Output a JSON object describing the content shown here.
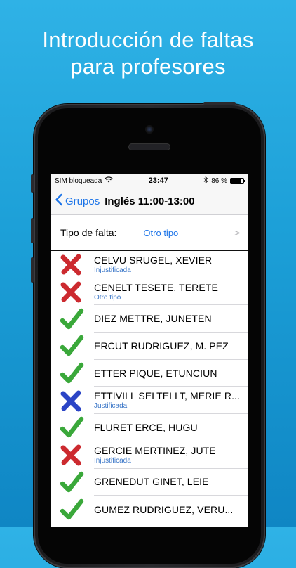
{
  "headline": {
    "line1": "Introducción de faltas",
    "line2": "para profesores"
  },
  "status_bar": {
    "carrier": "SIM bloqueada",
    "time": "23:47",
    "battery_text": "86 %",
    "battery_level": 0.86
  },
  "nav": {
    "back_label": "Grupos",
    "title": "Inglés 11:00-13:00"
  },
  "filter": {
    "label": "Tipo de falta:",
    "value": "Otro tipo",
    "chevron": ">"
  },
  "colors": {
    "red": "#cc2a2f",
    "green": "#3aa83a",
    "blue": "#2b45c6",
    "ios_blue": "#1a73e8"
  },
  "students": [
    {
      "name": "CELVU SRUGEL, XEVIER",
      "status": "cross-red",
      "note": "Injustificada"
    },
    {
      "name": "CENELT TESETE, TERETE",
      "status": "cross-red",
      "note": "Otro tipo"
    },
    {
      "name": "DIEZ METTRE, JUNETEN",
      "status": "check-green",
      "note": ""
    },
    {
      "name": "ERCUT RUDRIGUEZ, M. PEZ",
      "status": "check-green",
      "note": ""
    },
    {
      "name": "ETTER PIQUE, ETUNCIUN",
      "status": "check-green",
      "note": ""
    },
    {
      "name": "ETTIVILL SELTELLT, MERIE R...",
      "status": "cross-blue",
      "note": "Justificada"
    },
    {
      "name": "FLURET ERCE, HUGU",
      "status": "check-green",
      "note": ""
    },
    {
      "name": "GERCIE MERTINEZ, JUTE",
      "status": "cross-red",
      "note": "Injustificada"
    },
    {
      "name": "GRENEDUT GINET, LEIE",
      "status": "check-green",
      "note": ""
    },
    {
      "name": "GUMEZ RUDRIGUEZ, VERU...",
      "status": "check-green",
      "note": ""
    }
  ]
}
